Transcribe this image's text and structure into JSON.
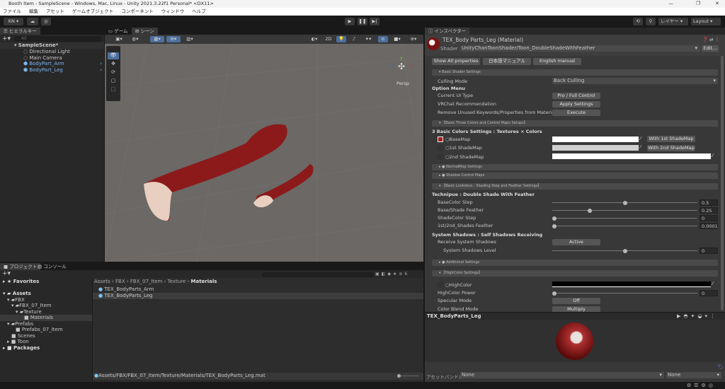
{
  "window": {
    "title": "Booth Item - SampleScene - Windows, Mac, Linux - Unity 2021.3.22f1 Personal* <DX11>",
    "controls": [
      "—",
      "❐",
      "✕"
    ]
  },
  "menu": [
    "ファイル",
    "編集",
    "アセット",
    "ゲームオブジェクト",
    "コンポーネント",
    "ウィンドウ",
    "ヘルプ"
  ],
  "toolbar": {
    "account": "KN ▾",
    "layers": "レイヤー",
    "layout": "Layout"
  },
  "hierarchy": {
    "tab": "ヒエラルキー",
    "search_placeholder": "All",
    "items": [
      {
        "label": "SampleScene*"
      },
      {
        "label": "Directional Light"
      },
      {
        "label": "Main Camera"
      },
      {
        "label": "BodyPart_Arm"
      },
      {
        "label": "BodyPart_Leg"
      }
    ]
  },
  "scene": {
    "tabs": [
      "ゲーム",
      "シーン"
    ],
    "persp": "Persp",
    "btn_2d": "2D",
    "gizmo_axes": [
      "y",
      "x",
      "z"
    ]
  },
  "project": {
    "tabs": [
      "プロジェクト",
      "コンソール"
    ],
    "favorites": "Favorites",
    "tree": [
      "Assets",
      "FBX",
      "FBX_07_Item",
      "Texture",
      "Materials",
      "Prefabs",
      "Prefabs_07_Item",
      "Scenes",
      "Toon",
      "Packages"
    ],
    "breadcrumb": [
      "Assets",
      "FBX",
      "FBX_07_Item",
      "Texture",
      "Materials"
    ],
    "files": [
      "TEX_BodyParts_Arm",
      "TEX_BodyParts_Leg"
    ],
    "path": "Assets/FBX/FBX_07_Item/Texture/Materials/TEX_BodyParts_Leg.mat",
    "hidden_count": "6"
  },
  "inspector": {
    "tab": "インスペクター",
    "title": "TEX_Body Parts_Leg (Material)",
    "shader_label": "Shader",
    "shader": "UnityChanToonShader/Toon_DoubleShadeWithFeather",
    "edit": "Edit...",
    "buttons": [
      "Show All properties",
      "日本語マニュアル",
      "English manual"
    ],
    "basic_shader": "Basic Shader Settings",
    "culling_label": "Culling Mode",
    "culling": "Back Culling",
    "option_menu": "Option Menu",
    "ui_type_label": "Current UI Type",
    "ui_type": "Pro / Full Control",
    "vrchat_label": "VRChat Recommendation",
    "vrchat": "Apply Settings",
    "remove_label": "Remove Unused Keywords/Properties from Materia",
    "remove": "Execute",
    "three_colors_section": "【Basic Three Colors and Control Maps Setups】",
    "three_colors_head": "3 Basic Colors Settings : Textures × Colors",
    "basemap": "BaseMap",
    "shade1": "1st ShadeMap",
    "shade2": "2nd ShadeMap",
    "with1": "With 1st ShadeMap",
    "with2": "With 2nd ShadeMap",
    "normalmap": "NormalMap Settings",
    "shadowmaps": "Shadow Control Maps",
    "lookdev_section": "【Basic Lookdevs : Shading Step and Feather Settings】",
    "technique": "Technipue : Double Shade With Feather",
    "sliders": [
      {
        "label": "BaseColor Step",
        "value": "0.5",
        "fraction": 0.5
      },
      {
        "label": "Base/Shade Feather",
        "value": "0.25",
        "fraction": 0.25
      },
      {
        "label": "ShadeColor Step",
        "value": "0",
        "fraction": 0
      },
      {
        "label": "1st/2nd_Shades Feather",
        "value": "0.0001",
        "fraction": 0.0001
      }
    ],
    "sys_shadows": "System Shadows : Self Shadows Receiving",
    "receive_label": "Receive System Shadows",
    "receive": "Active",
    "level_label": "System Shadows Level",
    "level": "0",
    "level_fraction": 0.5,
    "additional": "Additional Settings",
    "highcolor_section": "【HighColor Settings】",
    "highcolor": "HighColor",
    "hc_power_label": "HighColor Power",
    "hc_power": "0",
    "specular_label": "Specular Mode",
    "specular": "Off",
    "blend_label": "Color Blend Mode",
    "blend": "Multiply",
    "preview_title": "TEX_BodyParts_Leg",
    "assetbundle_label": "アセットバンドル",
    "assetbundle": "None",
    "variant": "None"
  },
  "colors": {
    "accent": "#4d6f9c",
    "panel": "#282828",
    "link": "#7cb6f0"
  }
}
